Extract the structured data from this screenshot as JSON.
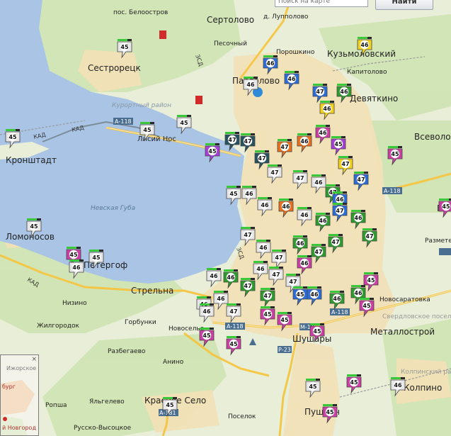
{
  "search": {
    "placeholder": "Поиск на карте",
    "button_label": "Найти"
  },
  "minimap": {
    "labels": [
      "Ижорское оз.",
      "бург",
      "й Новгород"
    ]
  },
  "water_labels": [
    "Невская Губа",
    "Курортный район"
  ],
  "road_labels": [
    "А-118",
    "КАД",
    "ЗСД",
    "М-11",
    "Р-23",
    "А-181"
  ],
  "place_labels": [
    "пос. Белоостров",
    "Сертолово",
    "д. Лупполово",
    "Песочный",
    "Порошкино",
    "Кузьмоловский",
    "Капитолово",
    "Парголово",
    "Девяткино",
    "Сестрорецк",
    "Лисий Нос",
    "Кронштадт",
    "Всеволож",
    "Павло",
    "Ломоносов",
    "Петергоф",
    "Стрельна",
    "Низино",
    "Горбунки",
    "Жилгородок",
    "Разбегаево",
    "Новоселье",
    "Анино",
    "Шушары",
    "Металлострой",
    "Колпинский район",
    "Колпино",
    "Свердловское поселение",
    "Ропша",
    "Яльгелево",
    "Красное Село",
    "Русско-Высоцкое",
    "Поселок",
    "Пушкин",
    "Разметелево",
    "Новосаратовка"
  ],
  "marker_legend": [
    {
      "number": "45",
      "color": "#a03bd0"
    },
    {
      "number": "46",
      "color": "#2f6fd8"
    },
    {
      "number": "47",
      "color": "#2f9a2f"
    }
  ],
  "markers": [
    {
      "n": "45",
      "c": "#e6e6e6"
    },
    {
      "n": "45",
      "c": "#e6e6e6"
    },
    {
      "n": "45",
      "c": "#e6e6e6"
    },
    {
      "n": "46",
      "c": "#f2d21e"
    },
    {
      "n": "46",
      "c": "#2d6cd5"
    },
    {
      "n": "46",
      "c": "#2d6cd5"
    },
    {
      "n": "47",
      "c": "#2d6cd5"
    },
    {
      "n": "46",
      "c": "#2f9a2f"
    },
    {
      "n": "46",
      "c": "#f2d21e"
    },
    {
      "n": "46",
      "c": "#e6e6e6"
    },
    {
      "n": "45",
      "c": "#e6e6e6"
    },
    {
      "n": "45",
      "c": "#e6e6e6"
    },
    {
      "n": "45",
      "c": "#a63fd6"
    },
    {
      "n": "47",
      "c": "#26515e"
    },
    {
      "n": "47",
      "c": "#26515e"
    },
    {
      "n": "47",
      "c": "#26515e"
    },
    {
      "n": "47",
      "c": "#e8701e"
    },
    {
      "n": "46",
      "c": "#e8701e"
    },
    {
      "n": "46",
      "c": "#c93fa3"
    },
    {
      "n": "45",
      "c": "#a63fd6"
    },
    {
      "n": "45",
      "c": "#c93fa3"
    },
    {
      "n": "47",
      "c": "#e6e6e6"
    },
    {
      "n": "47",
      "c": "#e6e6e6"
    },
    {
      "n": "46",
      "c": "#e6e6e6"
    },
    {
      "n": "47",
      "c": "#2f9a2f"
    },
    {
      "n": "47",
      "c": "#f2d21e"
    },
    {
      "n": "47",
      "c": "#2d6cd5"
    },
    {
      "n": "46",
      "c": "#2d6cd5"
    },
    {
      "n": "45",
      "c": "#e6e6e6"
    },
    {
      "n": "45",
      "c": "#c93fa3"
    },
    {
      "n": "46",
      "c": "#e6e6e6"
    },
    {
      "n": "46",
      "c": "#e6e6e6"
    },
    {
      "n": "46",
      "c": "#e8701e"
    },
    {
      "n": "46",
      "c": "#e6e6e6"
    },
    {
      "n": "46",
      "c": "#2f9a2f"
    },
    {
      "n": "47",
      "c": "#2d6cd5"
    },
    {
      "n": "46",
      "c": "#2f9a2f"
    },
    {
      "n": "47",
      "c": "#2f9a2f"
    },
    {
      "n": "47",
      "c": "#e6e6e6"
    },
    {
      "n": "46",
      "c": "#e6e6e6"
    },
    {
      "n": "47",
      "c": "#e6e6e6"
    },
    {
      "n": "46",
      "c": "#2f9a2f"
    },
    {
      "n": "47",
      "c": "#2f9a2f"
    },
    {
      "n": "47",
      "c": "#2f9a2f"
    },
    {
      "n": "46",
      "c": "#e6e6e6"
    },
    {
      "n": "47",
      "c": "#e6e6e6"
    },
    {
      "n": "47",
      "c": "#e6e6e6"
    },
    {
      "n": "46",
      "c": "#c93fa3"
    },
    {
      "n": "46",
      "c": "#e6e6e6"
    },
    {
      "n": "46",
      "c": "#2f9a2f"
    },
    {
      "n": "47",
      "c": "#2f9a2f"
    },
    {
      "n": "47",
      "c": "#2f9a2f"
    },
    {
      "n": "46",
      "c": "#e6e6e6"
    },
    {
      "n": "47",
      "c": "#e6e6e6"
    },
    {
      "n": "46",
      "c": "#e6e6e6"
    },
    {
      "n": "46",
      "c": "#e6e6e6"
    },
    {
      "n": "45",
      "c": "#2d6cd5"
    },
    {
      "n": "46",
      "c": "#2d6cd5"
    },
    {
      "n": "46",
      "c": "#2f9a2f"
    },
    {
      "n": "46",
      "c": "#2f9a2f"
    },
    {
      "n": "45",
      "c": "#c93fa3"
    },
    {
      "n": "45",
      "c": "#c93fa3"
    },
    {
      "n": "45",
      "c": "#c93fa3"
    },
    {
      "n": "45",
      "c": "#e6e6e6"
    },
    {
      "n": "46",
      "c": "#e6e6e6"
    },
    {
      "n": "45",
      "c": "#e6e6e6"
    },
    {
      "n": "45",
      "c": "#c93fa3"
    },
    {
      "n": "45",
      "c": "#c93fa3"
    },
    {
      "n": "45",
      "c": "#c93fa3"
    },
    {
      "n": "45",
      "c": "#c93fa3"
    },
    {
      "n": "45",
      "c": "#c93fa3"
    },
    {
      "n": "45",
      "c": "#c93fa3"
    },
    {
      "n": "46",
      "c": "#e6e6e6"
    },
    {
      "n": "45",
      "c": "#e6e6e6"
    },
    {
      "n": "45",
      "c": "#c93fa3"
    }
  ]
}
